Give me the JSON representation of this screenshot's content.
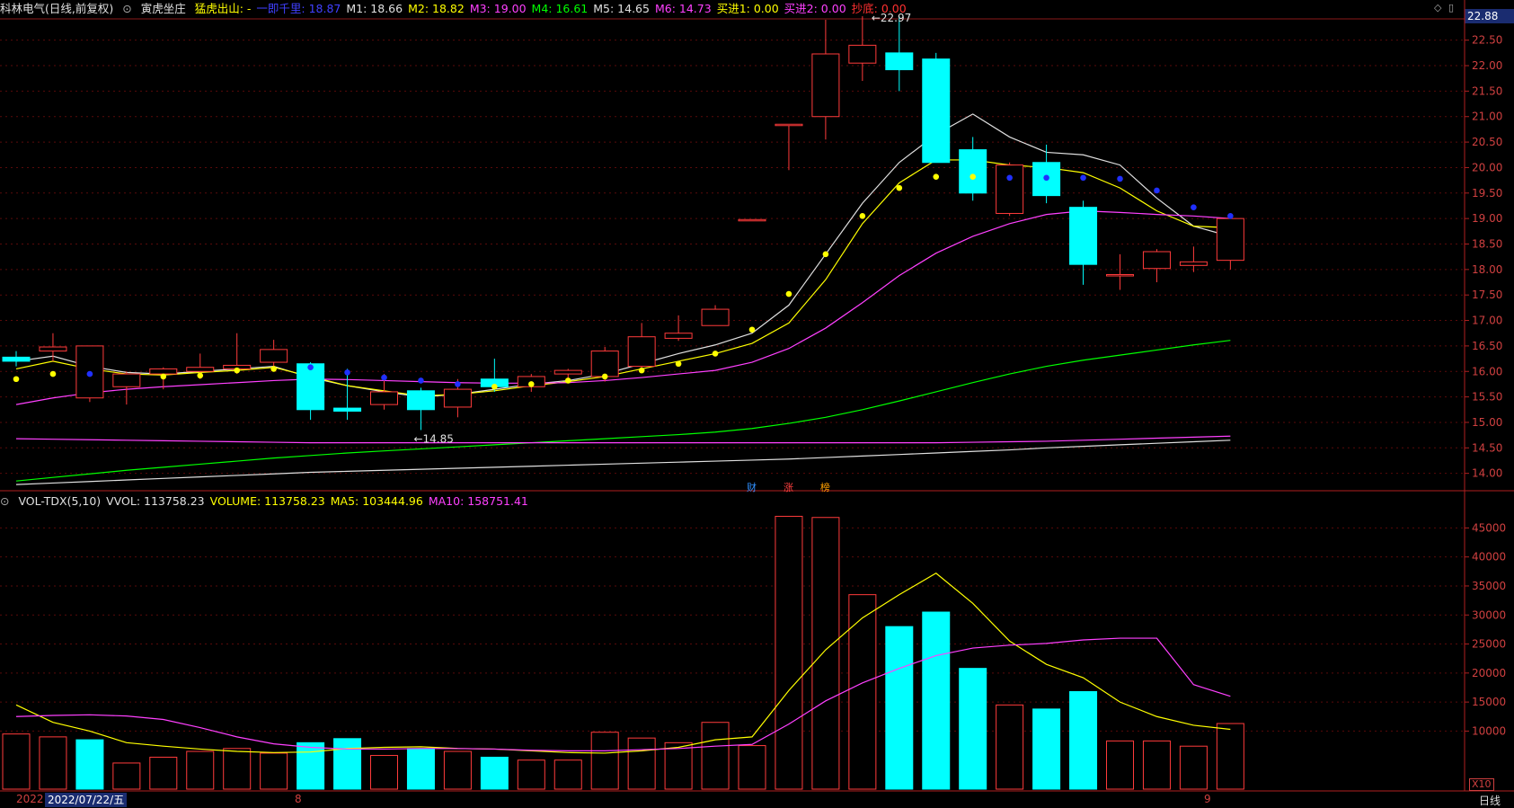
{
  "header": {
    "title": "科林电气(日线,前复权)",
    "indicator_name": "寅虎坐庄",
    "items": [
      {
        "label": "猛虎出山: -",
        "color": "#ffff00"
      },
      {
        "label": "一即千里: 18.87",
        "color": "#4040ff"
      },
      {
        "label": "M1: 18.66",
        "color": "#e0e0e0"
      },
      {
        "label": "M2: 18.82",
        "color": "#ffff00"
      },
      {
        "label": "M3: 19.00",
        "color": "#ff40ff"
      },
      {
        "label": "M4: 16.61",
        "color": "#00ff00"
      },
      {
        "label": "M5: 14.65",
        "color": "#e0e0e0"
      },
      {
        "label": "M6: 14.73",
        "color": "#ff40ff"
      },
      {
        "label": "买进1: 0.00",
        "color": "#ffff00"
      },
      {
        "label": "买进2: 0.00",
        "color": "#ff40ff"
      },
      {
        "label": "抄底: 0.00",
        "color": "#ff3030"
      }
    ],
    "last_price": "22.88"
  },
  "volume_header": {
    "items": [
      {
        "label": "VOL-TDX(5,10)",
        "color": "#e0e0e0"
      },
      {
        "label": "VVOL: 113758.23",
        "color": "#e0e0e0"
      },
      {
        "label": "VOLUME: 113758.23",
        "color": "#ffff00"
      },
      {
        "label": "MA5: 103444.96",
        "color": "#ffff00"
      },
      {
        "label": "MA10: 158751.41",
        "color": "#ff40ff"
      }
    ]
  },
  "footer": {
    "date_label": "2022/07/22/五",
    "year_prefix": "2022",
    "month_8": "8",
    "month_9": "9",
    "scale_badge": "X10",
    "period": "日线"
  },
  "events": [
    {
      "label": "财",
      "color": "#3090ff"
    },
    {
      "label": "涨",
      "color": "#ff4040"
    },
    {
      "label": "榜",
      "color": "#ffa000"
    }
  ],
  "chart_data": [
    {
      "type": "candlestick",
      "ylim": [
        13.8,
        22.9
      ],
      "yticks": [
        14.0,
        14.5,
        15.0,
        15.5,
        16.0,
        16.5,
        17.0,
        17.5,
        18.0,
        18.5,
        19.0,
        19.5,
        20.0,
        20.5,
        21.0,
        21.5,
        22.0,
        22.5
      ],
      "annotations": [
        {
          "label": "22.97",
          "value": 22.97
        },
        {
          "label": "14.85",
          "value": 14.85
        }
      ],
      "ohlc": [
        [
          16.28,
          16.4,
          16.1,
          16.2
        ],
        [
          16.4,
          16.75,
          16.2,
          16.48
        ],
        [
          15.48,
          16.5,
          15.4,
          16.5
        ],
        [
          15.7,
          16.0,
          15.35,
          15.95
        ],
        [
          15.95,
          16.08,
          15.65,
          16.05
        ],
        [
          16.0,
          16.35,
          15.85,
          16.08
        ],
        [
          16.05,
          16.75,
          15.95,
          16.12
        ],
        [
          16.18,
          16.62,
          16.05,
          16.43
        ],
        [
          16.15,
          16.18,
          15.05,
          15.25
        ],
        [
          15.28,
          16.05,
          15.05,
          15.22
        ],
        [
          15.35,
          15.95,
          15.25,
          15.6
        ],
        [
          15.62,
          15.68,
          14.85,
          15.25
        ],
        [
          15.3,
          15.85,
          15.1,
          15.65
        ],
        [
          15.85,
          16.25,
          15.6,
          15.7
        ],
        [
          15.7,
          15.95,
          15.6,
          15.9
        ],
        [
          15.95,
          16.05,
          15.8,
          16.02
        ],
        [
          15.9,
          16.48,
          15.8,
          16.4
        ],
        [
          16.1,
          16.95,
          16.0,
          16.68
        ],
        [
          16.65,
          17.1,
          16.6,
          16.75
        ],
        [
          16.9,
          17.3,
          16.9,
          17.22
        ],
        [
          18.98,
          18.98,
          18.98,
          18.98
        ],
        [
          20.85,
          20.85,
          19.95,
          20.85
        ],
        [
          21.0,
          22.9,
          20.55,
          22.23
        ],
        [
          22.05,
          22.97,
          21.7,
          22.4
        ],
        [
          22.25,
          22.97,
          21.5,
          21.92
        ],
        [
          22.13,
          22.25,
          20.1,
          20.1
        ],
        [
          20.35,
          20.6,
          19.35,
          19.5
        ],
        [
          19.1,
          20.1,
          19.05,
          20.05
        ],
        [
          20.1,
          20.45,
          19.3,
          19.45
        ],
        [
          19.22,
          19.35,
          17.7,
          18.1
        ],
        [
          17.9,
          18.3,
          17.6,
          17.9
        ],
        [
          18.02,
          18.4,
          17.75,
          18.35
        ],
        [
          18.08,
          18.45,
          17.95,
          18.15
        ],
        [
          18.18,
          19.0,
          18.0,
          19.0
        ]
      ],
      "series": [
        {
          "name": "M1",
          "color": "#e0e0e0",
          "values": [
            16.2,
            16.3,
            16.1,
            15.98,
            15.95,
            16.0,
            16.05,
            16.1,
            15.88,
            15.72,
            15.6,
            15.5,
            15.55,
            15.65,
            15.75,
            15.82,
            15.95,
            16.15,
            16.35,
            16.52,
            16.75,
            17.3,
            18.3,
            19.3,
            20.1,
            20.65,
            21.05,
            20.6,
            20.3,
            20.25,
            20.05,
            19.4,
            18.85,
            18.65
          ]
        },
        {
          "name": "M2",
          "color": "#ffff00",
          "values": [
            16.05,
            16.2,
            16.05,
            15.95,
            15.93,
            15.98,
            16.02,
            16.08,
            15.9,
            15.72,
            15.62,
            15.52,
            15.55,
            15.62,
            15.72,
            15.8,
            15.9,
            16.05,
            16.2,
            16.35,
            16.55,
            16.95,
            17.8,
            18.9,
            19.7,
            20.15,
            20.15,
            20.05,
            20.0,
            19.9,
            19.6,
            19.15,
            18.85,
            18.82
          ]
        },
        {
          "name": "M3",
          "color": "#ff40ff",
          "values": [
            15.35,
            15.48,
            15.58,
            15.65,
            15.7,
            15.74,
            15.78,
            15.82,
            15.85,
            15.84,
            15.82,
            15.8,
            15.78,
            15.77,
            15.77,
            15.78,
            15.82,
            15.88,
            15.95,
            16.02,
            16.18,
            16.45,
            16.85,
            17.35,
            17.88,
            18.32,
            18.65,
            18.9,
            19.08,
            19.15,
            19.12,
            19.08,
            19.05,
            19.0
          ]
        },
        {
          "name": "M4",
          "color": "#00ff00",
          "values": [
            13.85,
            13.92,
            13.99,
            14.06,
            14.12,
            14.18,
            14.24,
            14.3,
            14.35,
            14.4,
            14.44,
            14.48,
            14.52,
            14.56,
            14.6,
            14.64,
            14.68,
            14.72,
            14.76,
            14.81,
            14.88,
            14.98,
            15.1,
            15.25,
            15.42,
            15.6,
            15.78,
            15.95,
            16.1,
            16.22,
            16.32,
            16.42,
            16.52,
            16.61
          ]
        },
        {
          "name": "M5",
          "color": "#e0e0e0",
          "values": [
            13.78,
            13.81,
            13.84,
            13.87,
            13.9,
            13.93,
            13.96,
            13.99,
            14.02,
            14.04,
            14.06,
            14.08,
            14.1,
            14.12,
            14.14,
            14.16,
            14.18,
            14.2,
            14.22,
            14.24,
            14.26,
            14.28,
            14.31,
            14.34,
            14.37,
            14.4,
            14.43,
            14.46,
            14.5,
            14.53,
            14.56,
            14.59,
            14.62,
            14.65
          ]
        },
        {
          "name": "M6",
          "color": "#ff40ff",
          "values": [
            14.68,
            14.67,
            14.66,
            14.65,
            14.64,
            14.63,
            14.62,
            14.61,
            14.6,
            14.6,
            14.6,
            14.6,
            14.6,
            14.6,
            14.6,
            14.6,
            14.6,
            14.6,
            14.6,
            14.6,
            14.6,
            14.6,
            14.6,
            14.6,
            14.6,
            14.6,
            14.61,
            14.62,
            14.63,
            14.65,
            14.67,
            14.69,
            14.71,
            14.73
          ]
        }
      ],
      "dots": [
        {
          "color": "#ffff00",
          "values": [
            15.85,
            15.95,
            null,
            null,
            15.9,
            15.92,
            16.02,
            16.05,
            null,
            null,
            null,
            null,
            null,
            15.7,
            15.75,
            15.82,
            15.9,
            16.02,
            16.15,
            16.35,
            16.82,
            17.52,
            18.3,
            19.05,
            19.6,
            19.82,
            19.82,
            null,
            null,
            null,
            null,
            null,
            null,
            null
          ]
        },
        {
          "color": "#2030ff",
          "values": [
            null,
            null,
            15.95,
            null,
            null,
            null,
            null,
            null,
            16.08,
            15.98,
            15.88,
            15.82,
            15.75,
            null,
            null,
            null,
            null,
            null,
            null,
            null,
            null,
            null,
            null,
            null,
            null,
            null,
            null,
            19.8,
            19.8,
            19.8,
            19.78,
            19.55,
            19.22,
            19.05
          ]
        }
      ]
    },
    {
      "type": "bar",
      "ylim": [
        0,
        48000
      ],
      "yticks": [
        10000,
        15000,
        20000,
        25000,
        30000,
        35000,
        40000,
        45000
      ],
      "volume": [
        9500,
        9000,
        8500,
        4500,
        5500,
        6500,
        7000,
        6200,
        8000,
        8700,
        5800,
        7000,
        6500,
        5500,
        5000,
        5000,
        9800,
        8800,
        8000,
        11500,
        7500,
        47000,
        46800,
        33500,
        28000,
        30500,
        20800,
        14500,
        13800,
        16800,
        8300,
        8300,
        7400,
        11300
      ],
      "up": [
        true,
        true,
        false,
        true,
        true,
        true,
        true,
        true,
        false,
        false,
        true,
        false,
        true,
        false,
        true,
        true,
        true,
        true,
        true,
        true,
        true,
        true,
        true,
        true,
        false,
        false,
        false,
        true,
        false,
        false,
        true,
        true,
        true,
        true
      ],
      "series": [
        {
          "name": "MA5",
          "color": "#ffff00",
          "values": [
            14500,
            11500,
            10000,
            8000,
            7400,
            6900,
            6500,
            6300,
            6400,
            7000,
            7200,
            7300,
            7000,
            6900,
            6600,
            6300,
            6200,
            6600,
            7200,
            8500,
            9000,
            17000,
            24000,
            29500,
            33500,
            37200,
            32000,
            25500,
            21500,
            19200,
            15000,
            12500,
            11000,
            10300
          ]
        },
        {
          "name": "MA10",
          "color": "#ff40ff",
          "values": [
            12500,
            12700,
            12800,
            12600,
            12000,
            10600,
            9000,
            7800,
            7200,
            6900,
            6900,
            7000,
            7000,
            6900,
            6700,
            6600,
            6600,
            6800,
            7000,
            7400,
            7700,
            11200,
            15200,
            18300,
            20800,
            23000,
            24300,
            24800,
            25100,
            25700,
            26000,
            26000,
            18000,
            16000
          ]
        }
      ]
    }
  ]
}
